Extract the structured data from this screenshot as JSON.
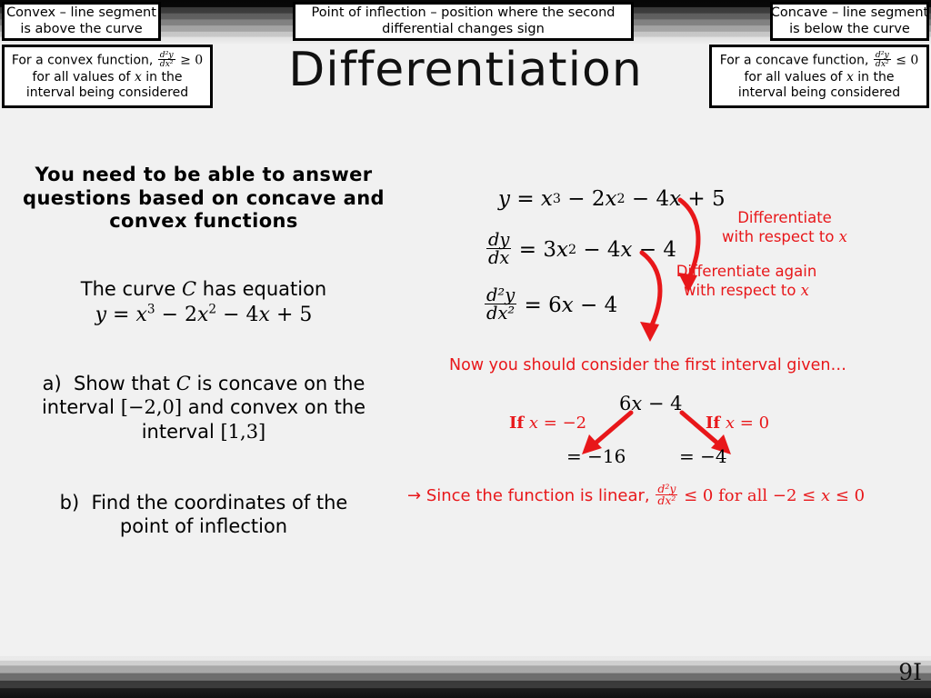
{
  "slide": {
    "title": "Differentiation",
    "page_number": "9I",
    "background_color": "#f1f1f1",
    "accent_color": "#e8171a"
  },
  "header_boxes": {
    "convex_definition": {
      "line1": "Convex – line segment",
      "line2": "is above the curve"
    },
    "convex_rule": {
      "line1_prefix": "For a convex function,",
      "fraction_numerator": "d²y",
      "fraction_denominator": "dx²",
      "relation": "≥ 0",
      "line2": "for all values of",
      "line2_var": "x",
      "line2_suffix": "in the",
      "line3": "interval being considered"
    },
    "inflection": {
      "line1": "Point of inflection – position where the second",
      "line2": "differential changes sign"
    },
    "concave_definition": {
      "line1": "Concave – line segment",
      "line2": "is below the curve"
    },
    "concave_rule": {
      "line1_prefix": "For a concave function,",
      "fraction_numerator": "d²y",
      "fraction_denominator": "dx²",
      "relation": "≤ 0",
      "line2": "for all values of",
      "line2_var": "x",
      "line2_suffix": "in the",
      "line3": "interval being considered"
    }
  },
  "left_column": {
    "objective": {
      "line1": "You need to be able to answer",
      "line2": "questions based on concave and",
      "line3": "convex functions"
    },
    "curve_statement": {
      "prefix": "The curve",
      "curve_label": "C",
      "suffix": "has equation"
    },
    "curve_equation": {
      "lhs": "y",
      "eq": "=",
      "term1_base": "x",
      "term1_exp": "3",
      "term2": "− 2",
      "term2_base": "x",
      "term2_exp": "2",
      "term3": "− 4",
      "term3_var": "x",
      "term4": "+ 5"
    },
    "part_a": {
      "marker": "a)",
      "line1": "Show that",
      "curve_label": "C",
      "line1_rest": "is concave on the",
      "line2_prefix": "interval",
      "interval1": "[−2,0]",
      "line2_mid": "and convex on the",
      "line3_prefix": "interval",
      "interval2": "[1,3]"
    },
    "part_b": {
      "marker": "b)",
      "line1": "Find the coordinates of the",
      "line2": "point of inflection"
    }
  },
  "working": {
    "equation_y": {
      "lhs": "y",
      "eq": "=",
      "base1": "x",
      "exp1": "3",
      "t2": "− 2",
      "base2": "x",
      "exp2": "2",
      "t3": "− 4",
      "var3": "x",
      "t4": "+ 5"
    },
    "equation_dy": {
      "num": "dy",
      "den": "dx",
      "eq": "=",
      "t1": "3",
      "base1": "x",
      "exp1": "2",
      "t2": "− 4",
      "var2": "x",
      "t3": "− 4"
    },
    "equation_d2y": {
      "num": "d²y",
      "den": "dx²",
      "eq": "=",
      "rhs": "6",
      "rhs_var": "x",
      "rhs_tail": "− 4"
    },
    "label_differentiate_1": {
      "line1": "Differentiate",
      "line2_prefix": "with respect to",
      "line2_var": "x"
    },
    "label_differentiate_2": {
      "line1": "Differentiate again",
      "line2_prefix": "with respect to",
      "line2_var": "x"
    },
    "note_first_interval": "Now you should consider the first interval given…",
    "expression_second_derivative": {
      "coef": "6",
      "var": "x",
      "tail": "− 4"
    },
    "branch_left": {
      "condition_prefix": "If",
      "condition_var": "x",
      "condition_value": "= −2",
      "result": "= −16"
    },
    "branch_right": {
      "condition_prefix": "If",
      "condition_var": "x",
      "condition_value": "= 0",
      "result": "= −4"
    },
    "conclusion": {
      "arrow": "→",
      "prefix": "Since the function is linear,",
      "fraction_numerator": "d²y",
      "fraction_denominator": "dx²",
      "relation": "≤ 0 for all −2 ≤",
      "relation_var": "x",
      "relation_tail": "≤ 0"
    }
  }
}
